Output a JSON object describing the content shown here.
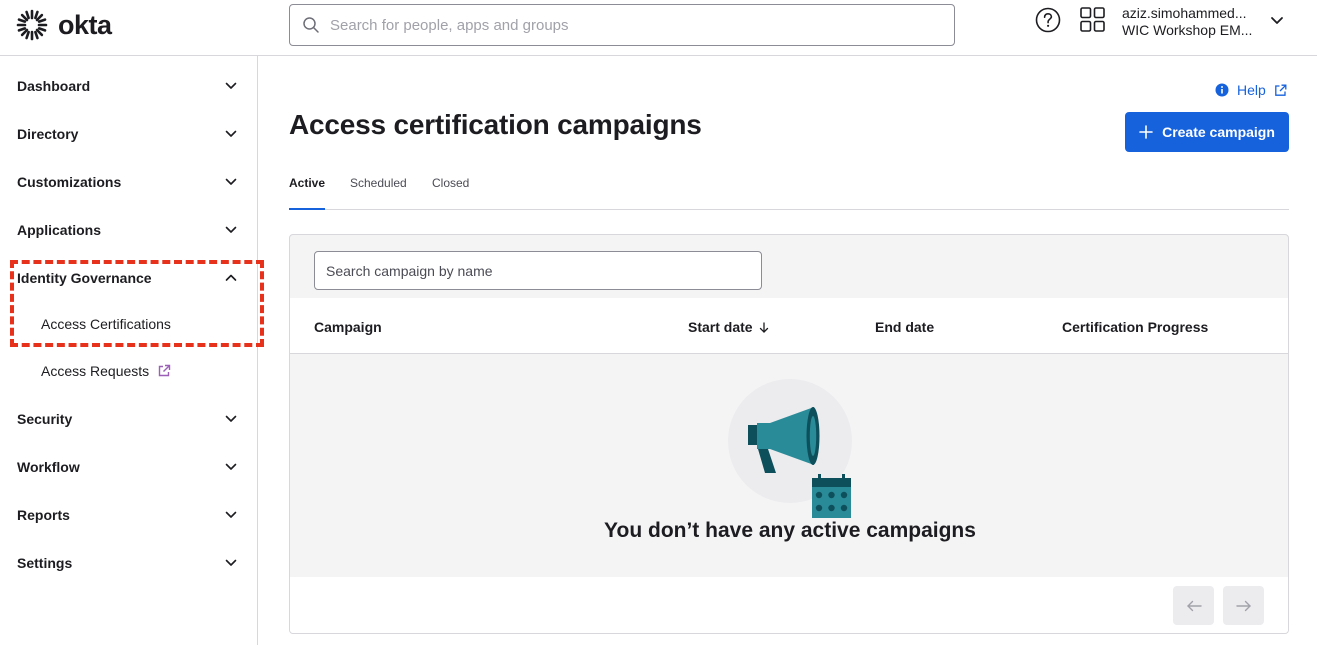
{
  "brand": {
    "name": "okta"
  },
  "header": {
    "search_placeholder": "Search for people, apps and groups",
    "user_name": "aziz.simohammed...",
    "user_org": "WIC Workshop EM..."
  },
  "sidebar": {
    "items": [
      {
        "label": "Dashboard"
      },
      {
        "label": "Directory"
      },
      {
        "label": "Customizations"
      },
      {
        "label": "Applications"
      },
      {
        "label": "Identity Governance"
      },
      {
        "label": "Security"
      },
      {
        "label": "Workflow"
      },
      {
        "label": "Reports"
      },
      {
        "label": "Settings"
      }
    ],
    "sub_items": [
      {
        "label": "Access Certifications"
      },
      {
        "label": "Access Requests"
      }
    ]
  },
  "main": {
    "help_label": "Help",
    "title": "Access certification campaigns",
    "create_label": "Create campaign",
    "tabs": [
      {
        "label": "Active"
      },
      {
        "label": "Scheduled"
      },
      {
        "label": "Closed"
      }
    ],
    "search_placeholder": "Search campaign by name",
    "columns": [
      "Campaign",
      "Start date",
      "End date",
      "Certification Progress"
    ],
    "empty_message": "You don’t have any active campaigns"
  },
  "colors": {
    "accent": "#1662dd",
    "highlight": "#e8311b",
    "illustration_teal": "#2a8b98",
    "illustration_dark": "#0e4f5c"
  }
}
